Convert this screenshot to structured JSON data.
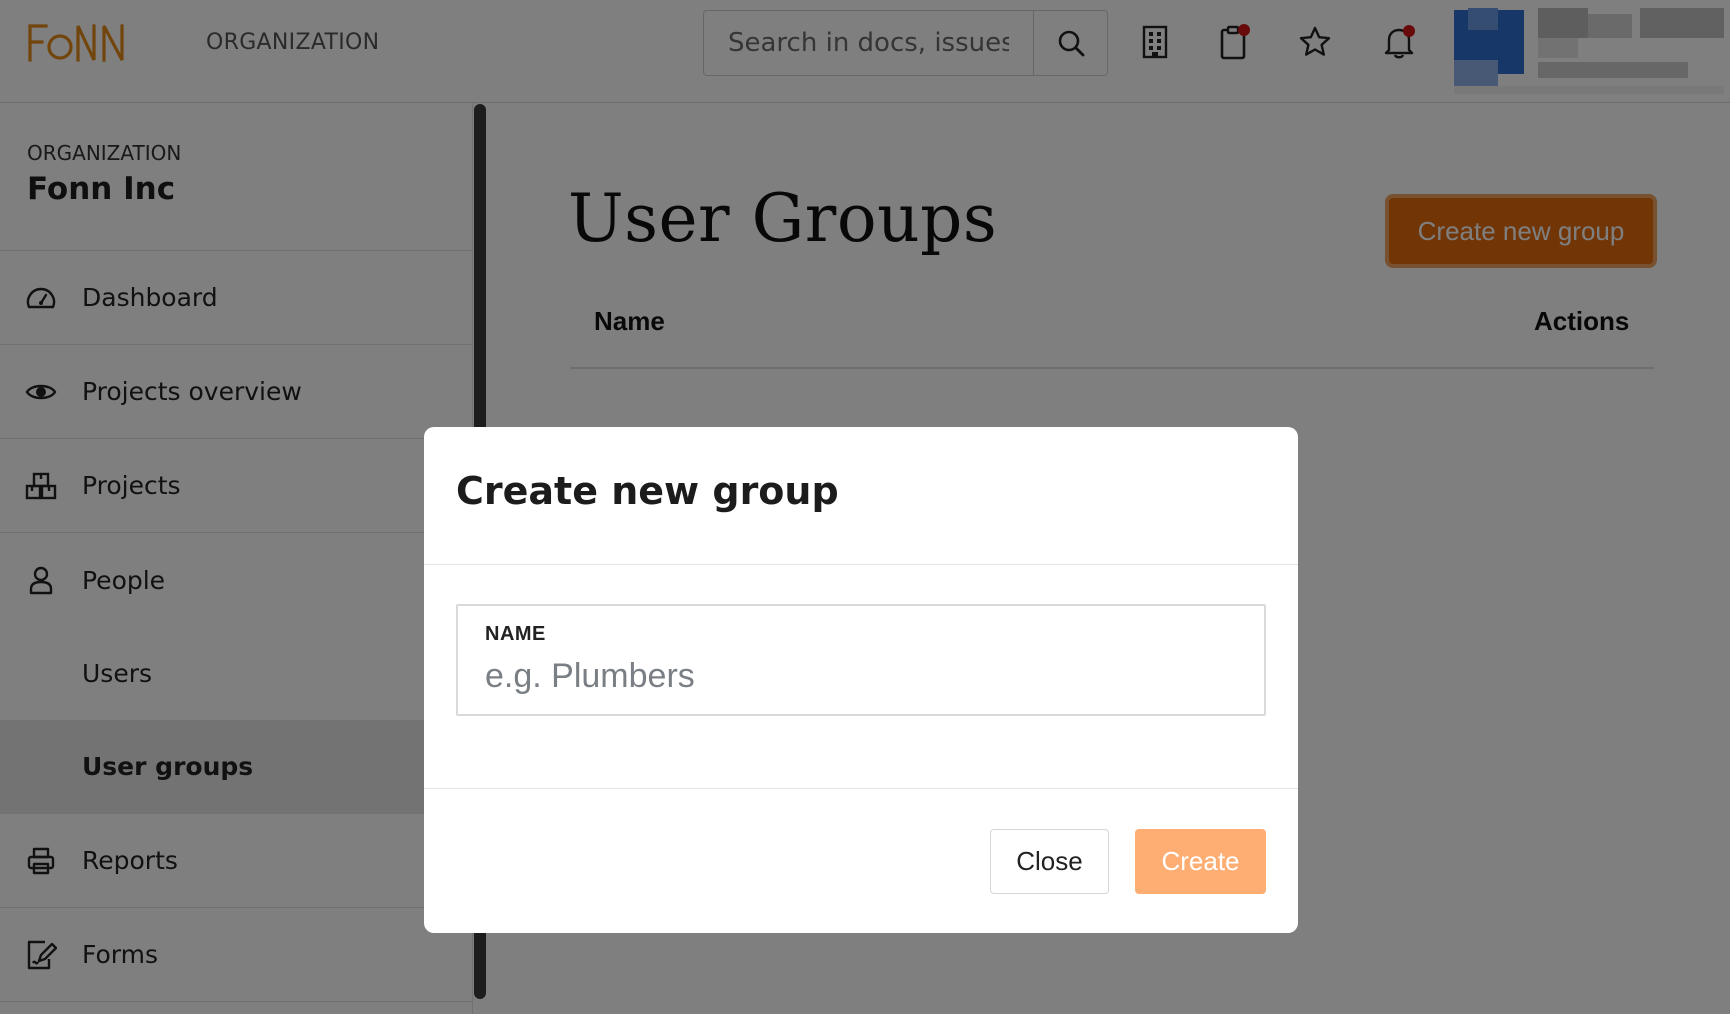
{
  "header": {
    "logo_text": "FONN",
    "org_label": "ORGANIZATION",
    "search": {
      "placeholder": "Search in docs, issues.."
    },
    "icons": [
      "search-icon",
      "building-icon",
      "clipboard-icon",
      "star-icon",
      "bell-icon"
    ],
    "notification_color": "#d01414"
  },
  "sidebar": {
    "org_caption": "ORGANIZATION",
    "org_name": "Fonn Inc",
    "items": [
      {
        "label": "Dashboard",
        "icon": "gauge-icon"
      },
      {
        "label": "Projects overview",
        "icon": "eye-icon"
      },
      {
        "label": "Projects",
        "icon": "boxes-icon"
      },
      {
        "label": "People",
        "icon": "person-icon"
      },
      {
        "label": "Users",
        "sub": true
      },
      {
        "label": "User groups",
        "sub": true,
        "active": true
      },
      {
        "label": "Reports",
        "icon": "printer-icon"
      },
      {
        "label": "Forms",
        "icon": "form-edit-icon"
      }
    ]
  },
  "main": {
    "title": "User Groups",
    "create_button": "Create new group",
    "columns": [
      "Name",
      "Actions"
    ],
    "accent_color": "#e36b0c"
  },
  "modal": {
    "title": "Create new group",
    "field_label": "NAME",
    "field_placeholder": "e.g. Plumbers",
    "close_label": "Close",
    "create_label": "Create"
  }
}
